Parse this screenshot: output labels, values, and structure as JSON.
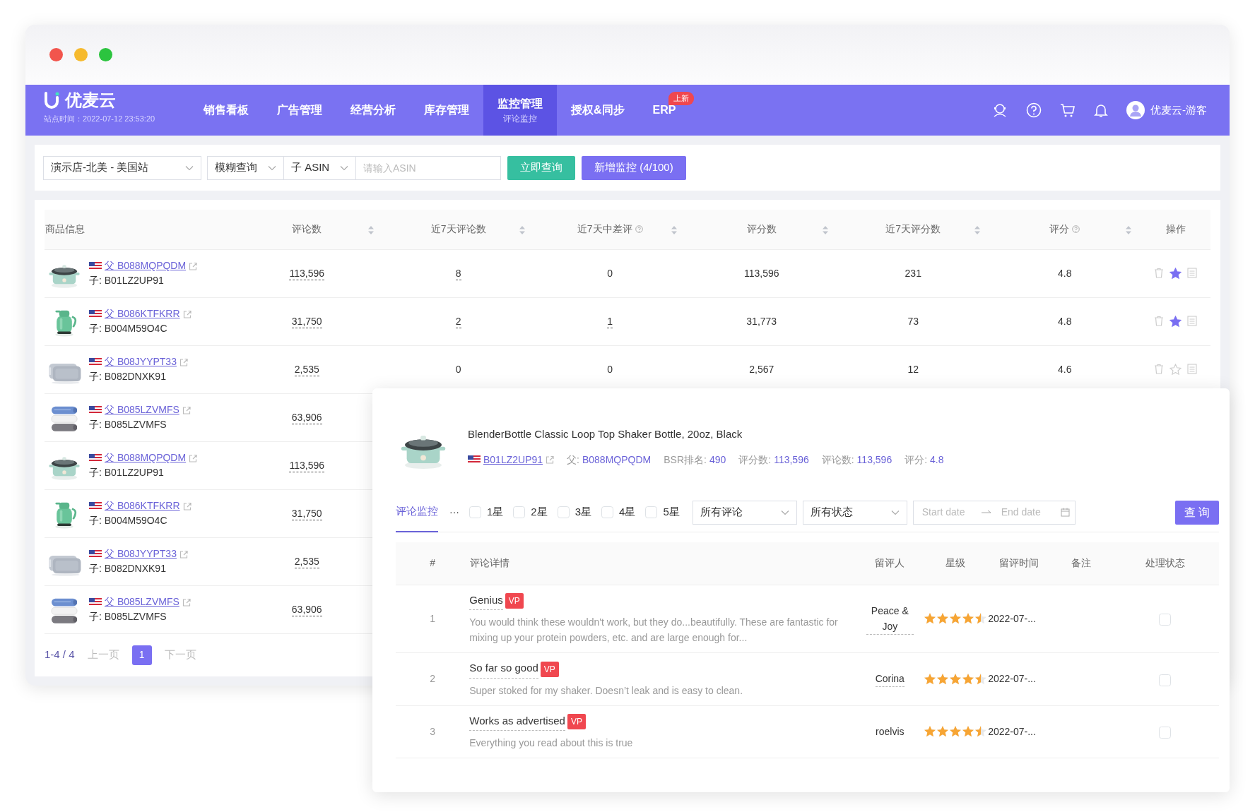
{
  "brand": {
    "name": "优麦云",
    "site_time": "站点时间：2022-07-12 23:53:20"
  },
  "nav": [
    {
      "label": "销售看板",
      "selected": false
    },
    {
      "label": "广告管理",
      "selected": false
    },
    {
      "label": "经营分析",
      "selected": false
    },
    {
      "label": "库存管理",
      "selected": false
    },
    {
      "label": "监控管理",
      "subtitle": "评论监控",
      "selected": true
    },
    {
      "label": "授权&同步",
      "selected": false
    },
    {
      "label": "ERP",
      "badge": "上新",
      "selected": false
    }
  ],
  "user": {
    "name": "优麦云-游客"
  },
  "filters": {
    "store": "演示店-北美 - 美国站",
    "match": "模糊查询",
    "asin_type": "子 ASIN",
    "asin_placeholder": "请输入ASIN",
    "search_button": "立即查询",
    "add_button": "新增监控 (4/100)"
  },
  "table": {
    "columns": [
      {
        "label": "商品信息",
        "sortable": false,
        "help": false
      },
      {
        "label": "评论数",
        "sortable": true,
        "help": false
      },
      {
        "label": "近7天评论数",
        "sortable": true,
        "help": false
      },
      {
        "label": "近7天中差评",
        "sortable": true,
        "help": true
      },
      {
        "label": "评分数",
        "sortable": true,
        "help": false
      },
      {
        "label": "近7天评分数",
        "sortable": true,
        "help": false
      },
      {
        "label": "评分",
        "sortable": true,
        "help": true
      },
      {
        "label": "操作",
        "sortable": false,
        "help": false
      }
    ],
    "rows": [
      {
        "parent": "父 B088MQPQDM",
        "child": "子: B01LZ2UP91",
        "reviews": "113,596",
        "recent_reviews": "8",
        "recent_reviews_link": true,
        "recent_negative": "0",
        "recent_negative_link": false,
        "ratings": "113,596",
        "recent_ratings": "231",
        "rating": "4.8",
        "starred": true
      },
      {
        "parent": "父 B086KTFKRR",
        "child": "子: B004M59O4C",
        "reviews": "31,750",
        "recent_reviews": "2",
        "recent_reviews_link": true,
        "recent_negative": "1",
        "recent_negative_link": true,
        "ratings": "31,773",
        "recent_ratings": "73",
        "rating": "4.8",
        "starred": true
      },
      {
        "parent": "父 B08JYYPT33",
        "child": "子: B082DNXK91",
        "reviews": "2,535",
        "recent_reviews": "0",
        "recent_reviews_link": false,
        "recent_negative": "0",
        "recent_negative_link": false,
        "ratings": "2,567",
        "recent_ratings": "12",
        "rating": "4.6",
        "starred": false
      },
      {
        "parent": "父 B085LZVMFS",
        "child": "子: B085LZVMFS",
        "reviews": "63,906"
      },
      {
        "parent": "父 B088MQPQDM",
        "child": "子: B01LZ2UP91",
        "reviews": "113,596"
      },
      {
        "parent": "父 B086KTFKRR",
        "child": "子: B004M59O4C",
        "reviews": "31,750"
      },
      {
        "parent": "父 B08JYYPT33",
        "child": "子: B082DNXK91",
        "reviews": "2,535"
      },
      {
        "parent": "父 B085LZVMFS",
        "child": "子: B085LZVMFS",
        "reviews": "63,906"
      }
    ]
  },
  "pagination": {
    "range": "1-4 / 4",
    "prev": "上一页",
    "pages": [
      {
        "label": "1",
        "selected": true
      }
    ],
    "next": "下一页"
  },
  "detail": {
    "title": "BlenderBottle Classic Loop Top Shaker Bottle, 20oz, Black",
    "asin": "B01LZ2UP91",
    "meta": [
      {
        "label": "父: ",
        "value": "B088MQPQDM"
      },
      {
        "label": "BSR排名: ",
        "value": "490"
      },
      {
        "label": "评分数: ",
        "value": "113,596"
      },
      {
        "label": "评论数: ",
        "value": "113,596"
      },
      {
        "label": "评分: ",
        "value": "4.8"
      }
    ],
    "tabs": [
      {
        "label": "评论监控",
        "selected": true
      }
    ],
    "more": "···",
    "star_filters": [
      {
        "label": "1星",
        "checked": false
      },
      {
        "label": "2星",
        "checked": false
      },
      {
        "label": "3星",
        "checked": false
      },
      {
        "label": "4星",
        "checked": false
      },
      {
        "label": "5星",
        "checked": false
      }
    ],
    "review_type": "所有评论",
    "status": "所有状态",
    "start_placeholder": "Start date",
    "end_placeholder": "End date",
    "query_button": "查 询",
    "columns": [
      "#",
      "评论详情",
      "留评人",
      "星级",
      "留评时间",
      "备注",
      "处理状态"
    ],
    "reviews": [
      {
        "index": "1",
        "title": "Genius",
        "badge": "VP",
        "body": "You would think these wouldn't work, but they do...beautifully. These are fantastic for mixing up your protein powders, etc. and are large enough for...",
        "reviewer": "Peace & Joy",
        "reviewer_link": true,
        "stars": 4.5,
        "date": "2022-07-...",
        "handled": false
      },
      {
        "index": "2",
        "title": "So far so good",
        "badge": "VP",
        "body": "Super stoked for my shaker. Doesn’t leak and is easy to clean.",
        "reviewer": "Corina",
        "reviewer_link": true,
        "stars": 4.5,
        "date": "2022-07-...",
        "handled": false
      },
      {
        "index": "3",
        "title": "Works as advertised",
        "badge": "VP",
        "body": "Everything you read about this is true",
        "reviewer": "roelvis",
        "reviewer_link": false,
        "stars": 4.5,
        "date": "2022-07-...",
        "handled": false
      }
    ]
  }
}
